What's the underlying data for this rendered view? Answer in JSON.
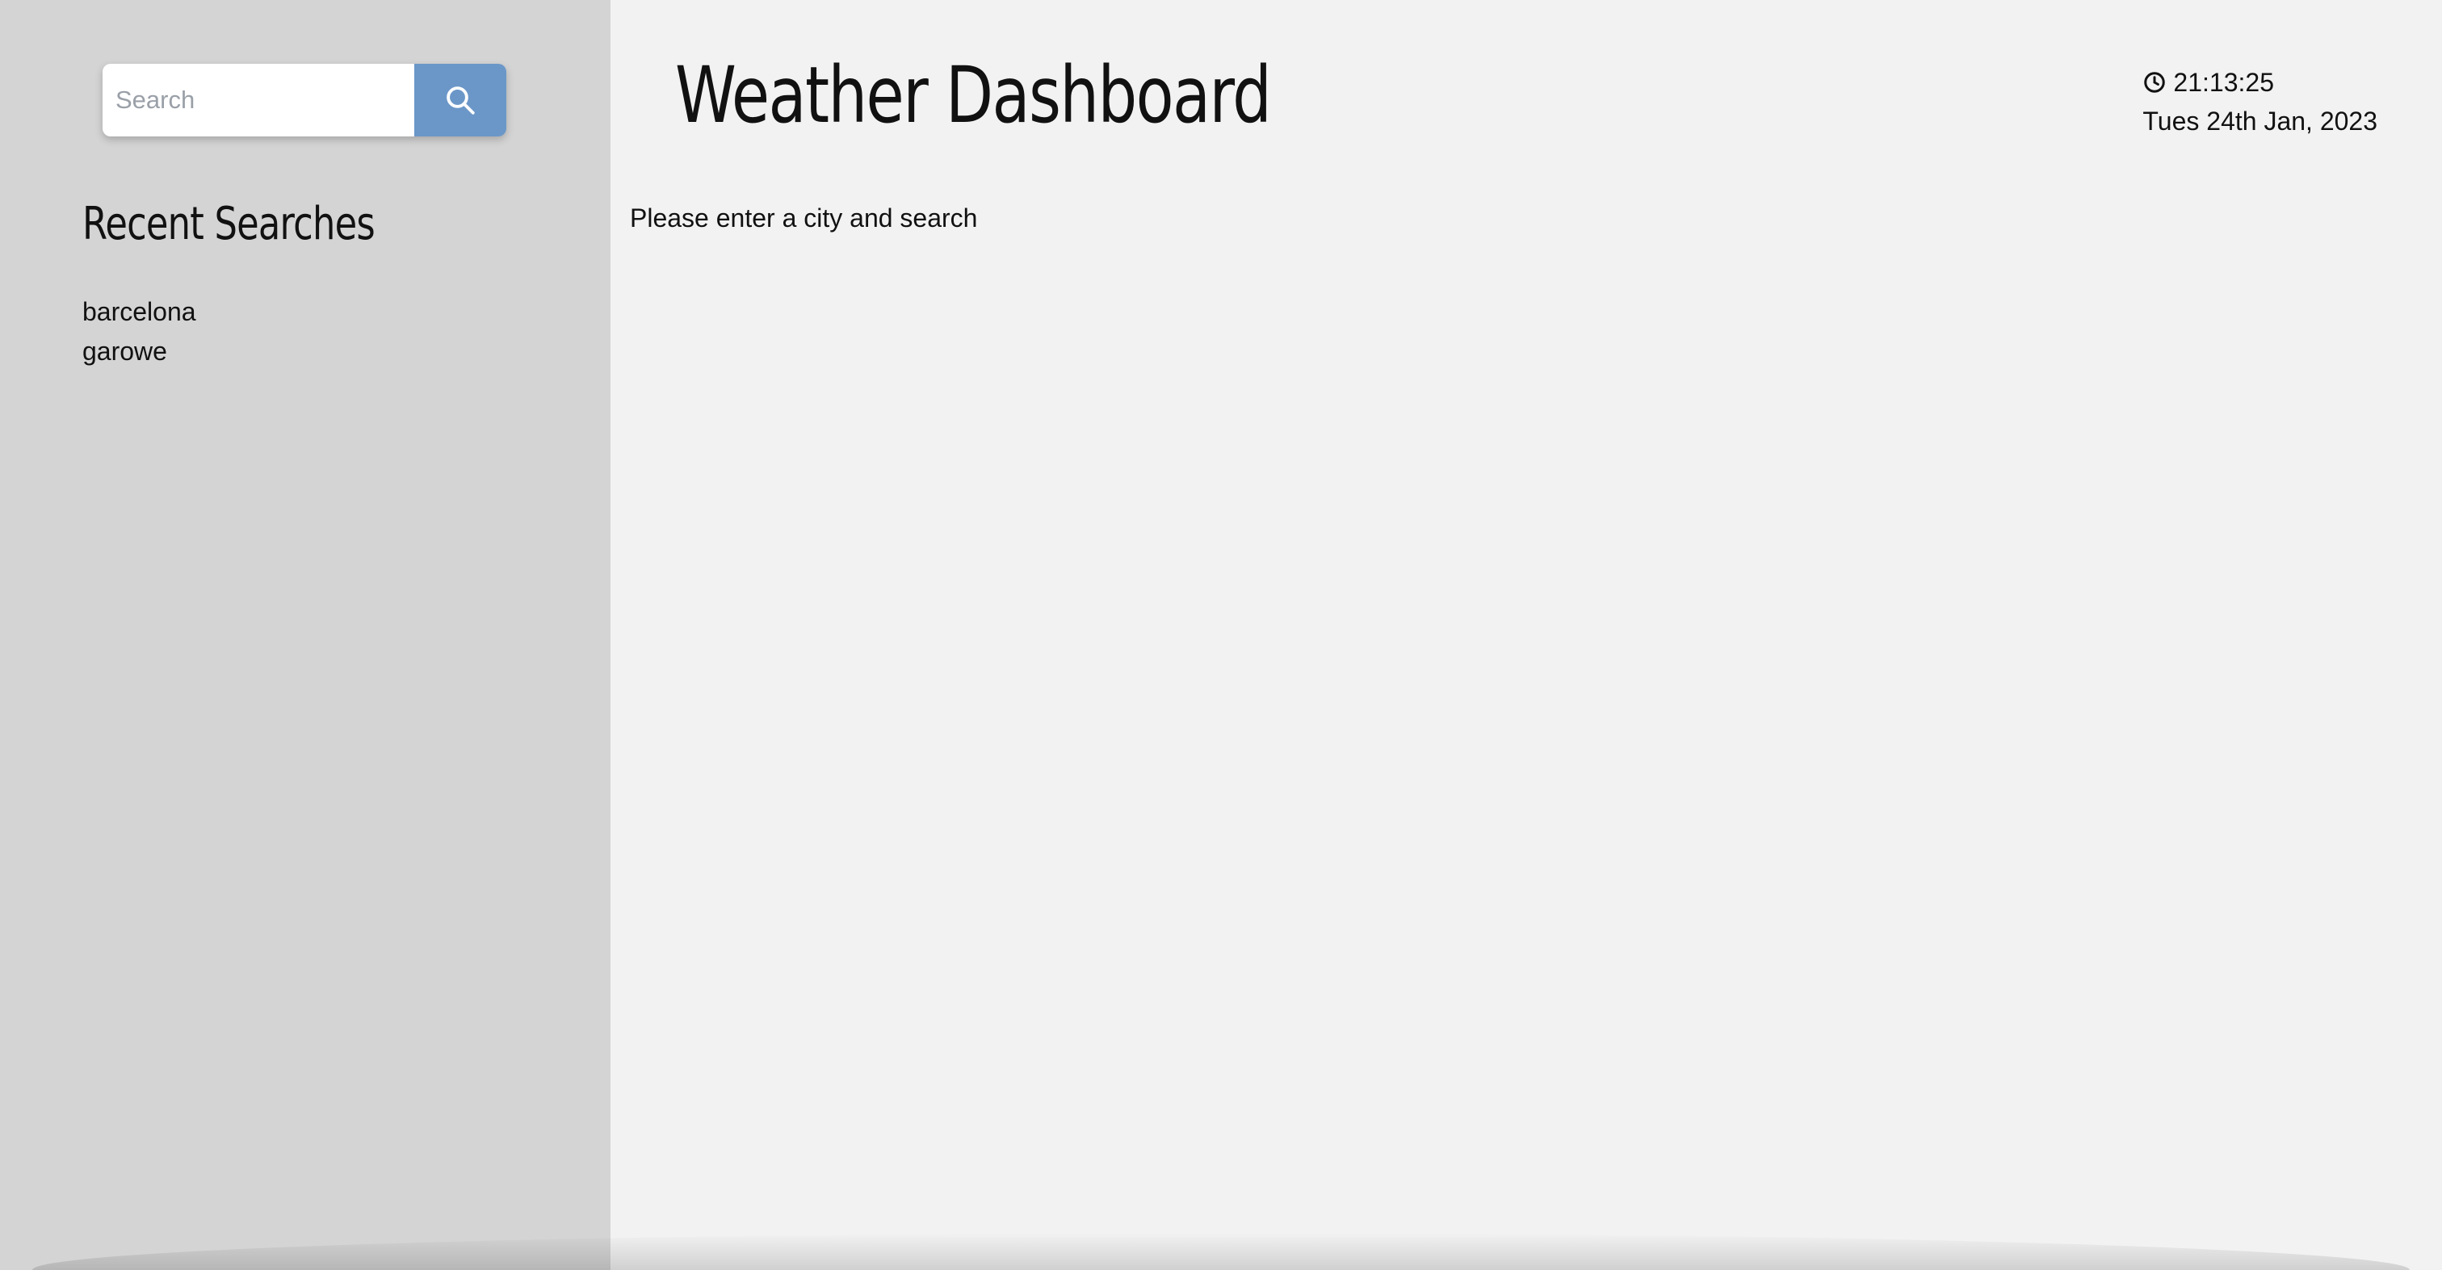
{
  "sidebar": {
    "search": {
      "placeholder": "Search",
      "value": "",
      "button_icon": "search-icon"
    },
    "recent_title": "Recent Searches",
    "recent_items": [
      {
        "label": "barcelona"
      },
      {
        "label": "garowe"
      }
    ]
  },
  "header": {
    "title": "Weather Dashboard",
    "time": "21:13:25",
    "date": "Tues 24th Jan, 2023",
    "clock_icon": "clock-icon"
  },
  "main": {
    "hint": "Please enter a city and search"
  },
  "colors": {
    "sidebar_bg": "#d4d4d4",
    "main_bg": "#f2f2f2",
    "accent": "#6b97c8"
  }
}
